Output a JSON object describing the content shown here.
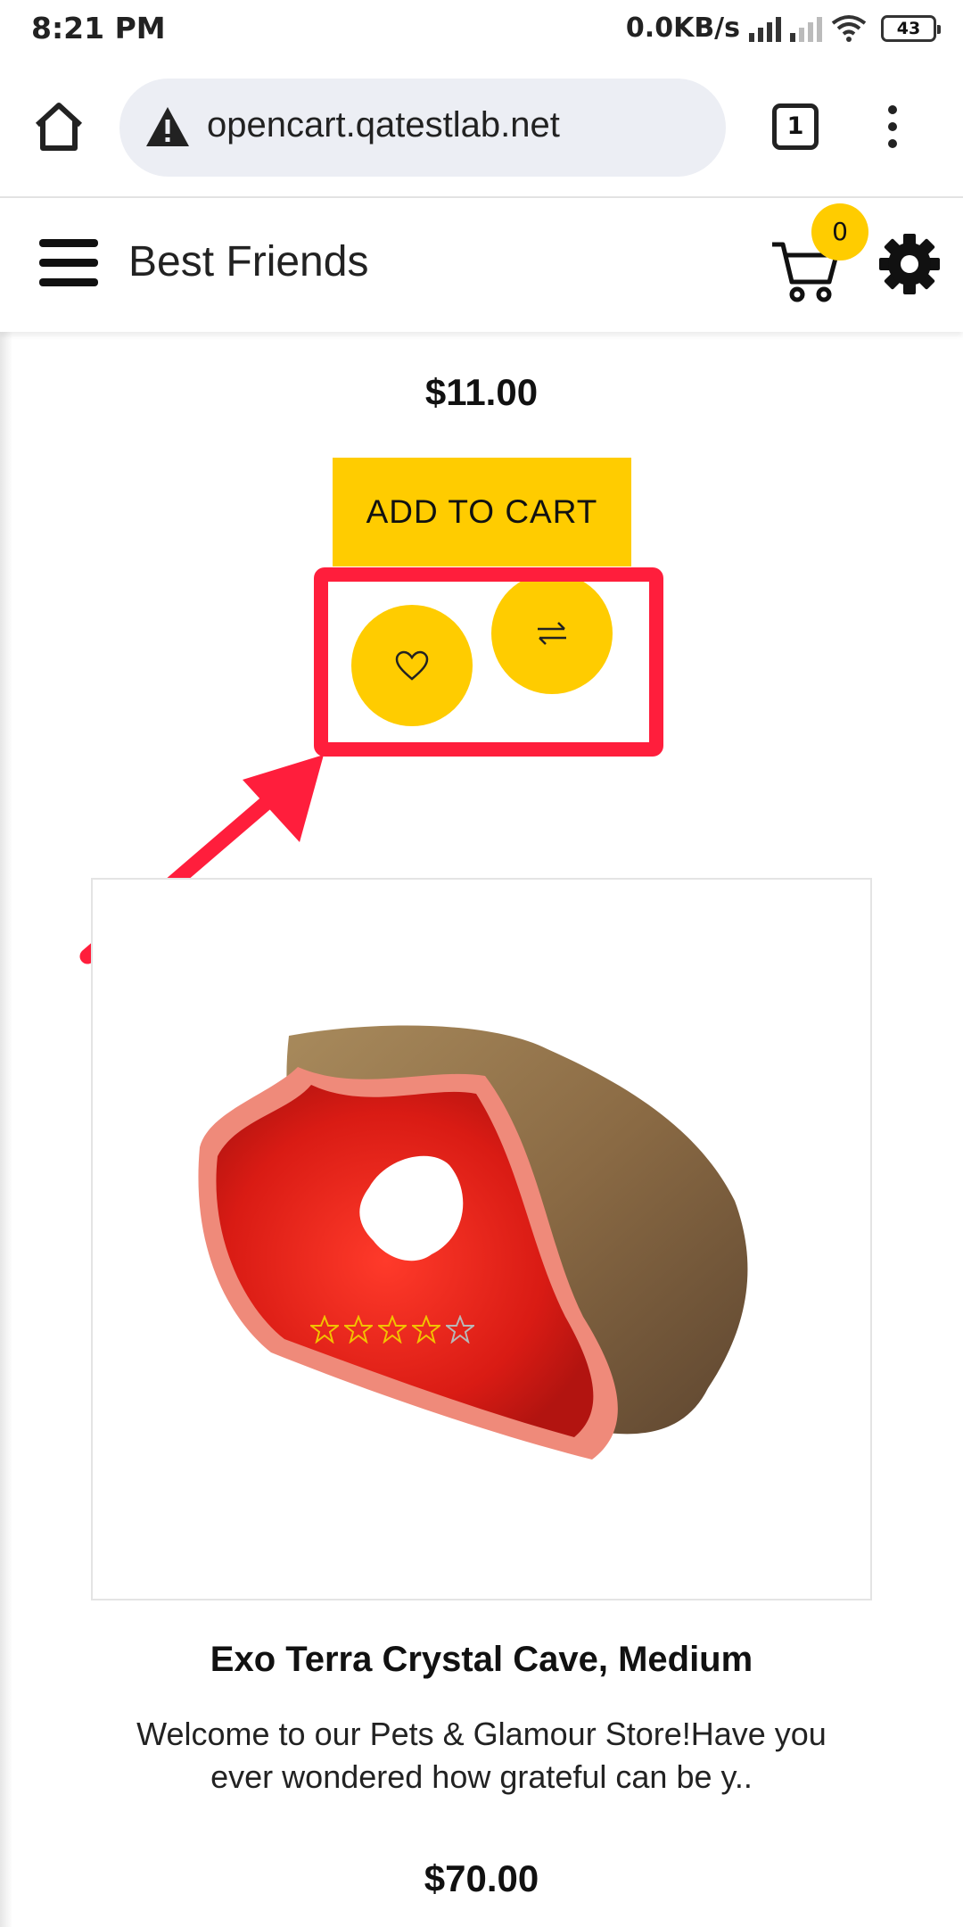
{
  "status_bar": {
    "time": "8:21 PM",
    "net_speed": "0.0KB/s",
    "battery": "43"
  },
  "browser": {
    "url": "opencart.qatestlab.net",
    "tab_count": "1",
    "icons": [
      "home-icon",
      "warning-icon",
      "tabs-icon",
      "more-vert-icon"
    ]
  },
  "header": {
    "store_name": "Best Friends",
    "cart_count": "0",
    "icons": [
      "menu-icon",
      "cart-icon",
      "gear-icon"
    ]
  },
  "product_prev": {
    "price": "$11.00",
    "add_to_cart_label": "ADD TO CART",
    "wishlist_icon": "heart-icon",
    "compare_icon": "compare-arrows-icon"
  },
  "annotation": {
    "highlight_color": "#ff1e3c"
  },
  "product_next": {
    "title": "Exo Terra Crystal Cave, Medium",
    "description": "Welcome to our Pets & Glamour Store!Have you ever wondered how grateful can be y..",
    "price": "$70.00",
    "rating": 4,
    "rating_max": 5
  },
  "colors": {
    "accent": "#ffcc00",
    "star": "#f2c200"
  }
}
